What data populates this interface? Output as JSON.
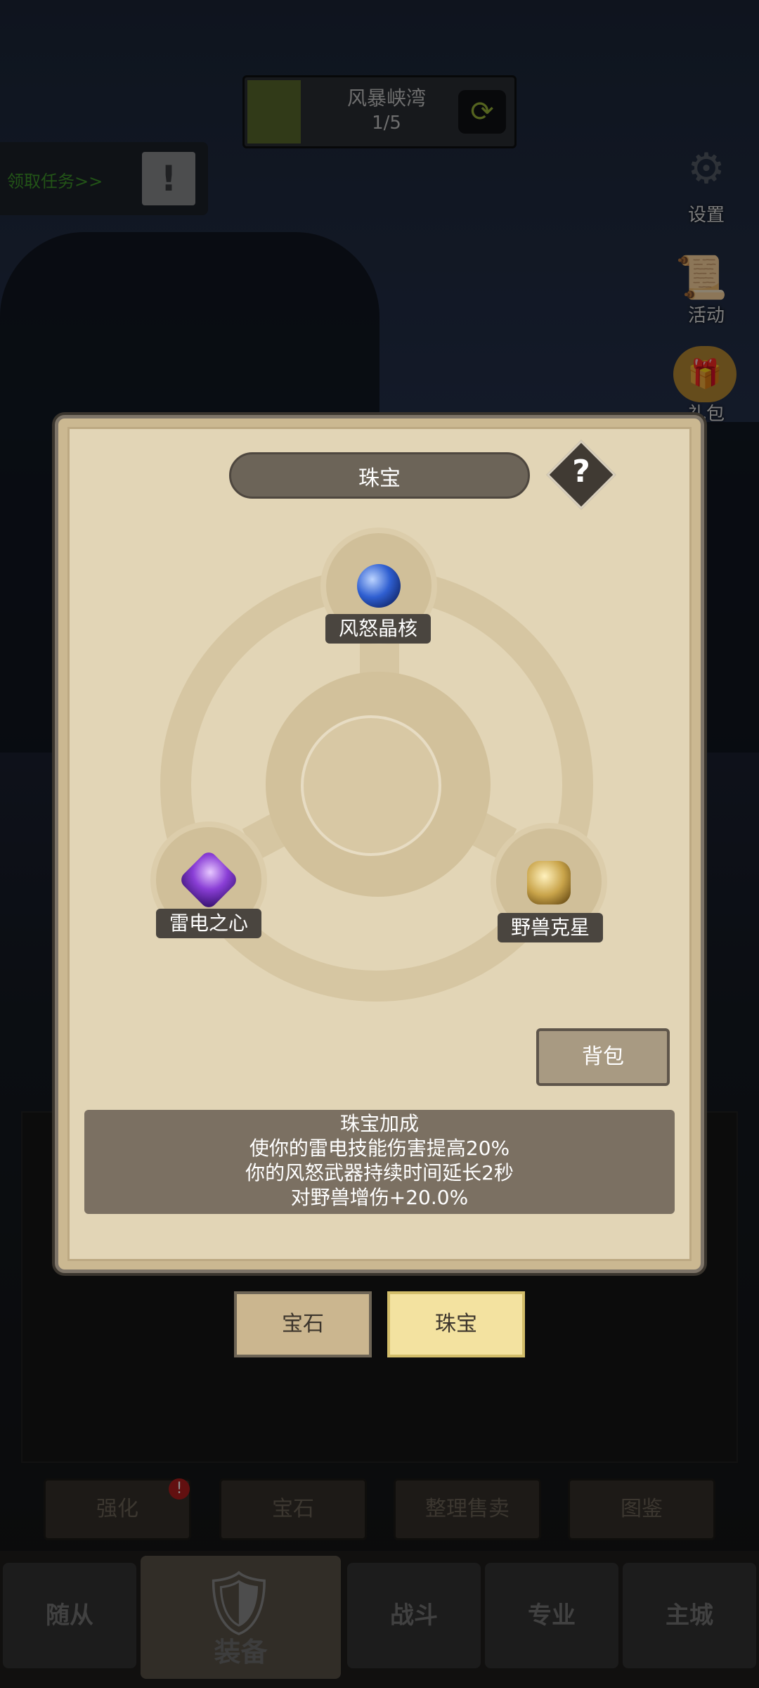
{
  "stage": {
    "name": "风暴峡湾",
    "progress": "1/5"
  },
  "quest": {
    "label": "领取任务>>"
  },
  "side_menu": {
    "settings": "设置",
    "events": "活动",
    "gift": "礼包"
  },
  "dialog": {
    "title": "珠宝",
    "help": "?",
    "jewels": {
      "top": "风怒晶核",
      "left": "雷电之心",
      "right": "野兽克星"
    },
    "bag_button": "背包",
    "bonus": {
      "heading": "珠宝加成",
      "lines": [
        "使你的雷电技能伤害提高20%",
        "你的风怒武器持续时间延长2秒",
        "对野兽增伤+20.0%"
      ]
    },
    "tabs": {
      "gem": "宝石",
      "jewel": "珠宝"
    }
  },
  "actions": {
    "enhance": "强化",
    "gem": "宝石",
    "sort_sell": "整理售卖",
    "codex": "图鉴",
    "badge": "!"
  },
  "nav": {
    "followers": "随从",
    "equipment": "装备",
    "battle": "战斗",
    "profession": "专业",
    "main_city": "主城"
  },
  "colors": {
    "parchment": "#e2d5b6",
    "active_tab": "#f3e2a0",
    "quest_text": "#3f9a2b"
  }
}
